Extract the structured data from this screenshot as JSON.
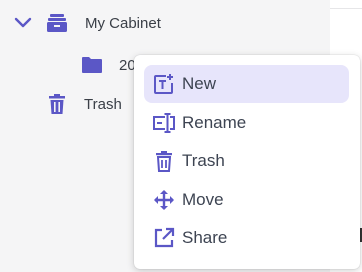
{
  "tree": {
    "root_label": "My Cabinet",
    "folder_label": "20",
    "trash_label": "Trash"
  },
  "context_menu": {
    "items": [
      {
        "label": "New",
        "icon": "new-text-icon"
      },
      {
        "label": "Rename",
        "icon": "rename-icon"
      },
      {
        "label": "Trash",
        "icon": "trash-icon"
      },
      {
        "label": "Move",
        "icon": "move-icon"
      },
      {
        "label": "Share",
        "icon": "share-icon"
      }
    ]
  },
  "colors": {
    "accent": "#5b57c6",
    "sidebar_bg": "#f5f5f6",
    "menu_active_bg": "#e7e5fb",
    "text": "#3d4452"
  }
}
